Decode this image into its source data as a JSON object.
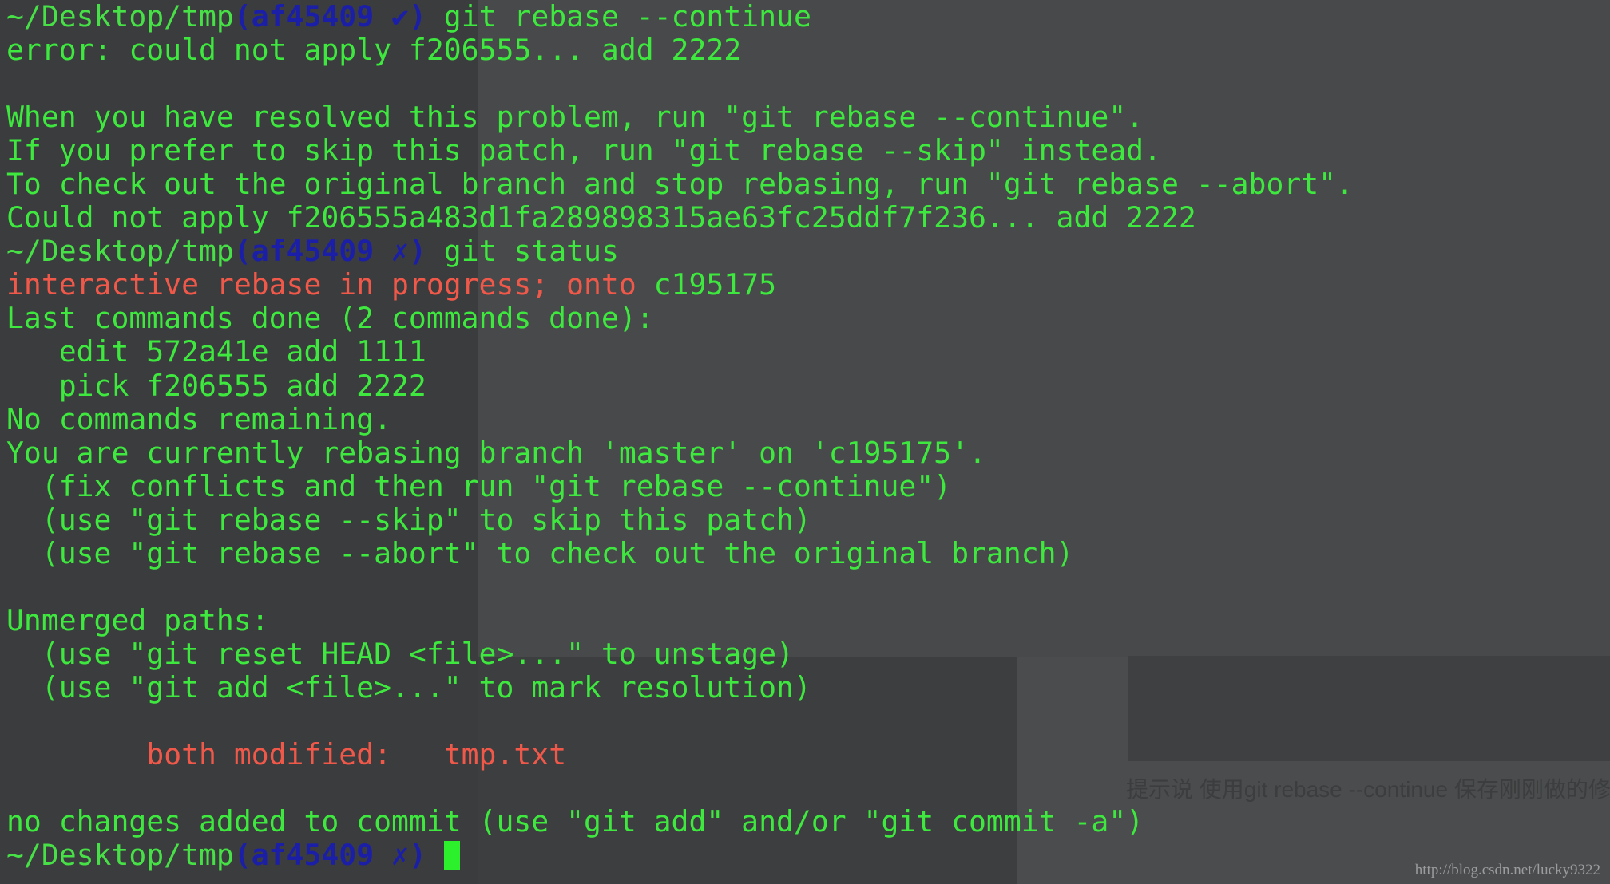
{
  "colors": {
    "output": "#3ee83e",
    "branch": "#1b1fa8",
    "error": "#f0584a",
    "background": "#3a3c3d"
  },
  "prompt": {
    "path": "~/Desktop/tmp",
    "branch_open": "(af45409",
    "ok_mark": "✔",
    "fail_mark": "✗",
    "branch_close": ")"
  },
  "lines": {
    "l1_cmd": " git rebase --continue",
    "l2": "error: could not apply f206555... add 2222",
    "l4": "When you have resolved this problem, run \"git rebase --continue\".",
    "l5": "If you prefer to skip this patch, run \"git rebase --skip\" instead.",
    "l6": "To check out the original branch and stop rebasing, run \"git rebase --abort\".",
    "l7": "Could not apply f206555a483d1fa289898315ae63fc25ddf7f236... add 2222",
    "l8_cmd": " git status",
    "l9_red": "interactive rebase in progress; onto",
    "l9_green": " c195175",
    "l10": "Last commands done (2 commands done):",
    "l11": "   edit 572a41e add 1111",
    "l12": "   pick f206555 add 2222",
    "l13": "No commands remaining.",
    "l14": "You are currently rebasing branch 'master' on 'c195175'.",
    "l15": "  (fix conflicts and then run \"git rebase --continue\")",
    "l16": "  (use \"git rebase --skip\" to skip this patch)",
    "l17": "  (use \"git rebase --abort\" to check out the original branch)",
    "l19": "Unmerged paths:",
    "l20": "  (use \"git reset HEAD <file>...\" to unstage)",
    "l21": "  (use \"git add <file>...\" to mark resolution)",
    "l23_indent": "        ",
    "l23_red": "both modified:   tmp.txt",
    "l25": "no changes added to commit (use \"git add\" and/or \"git commit -a\")",
    "l26_cmd": " "
  },
  "background_text": {
    "caption": "提示说 使用git rebase --continue 保存刚刚做的修"
  },
  "watermark": "http://blog.csdn.net/lucky9322"
}
